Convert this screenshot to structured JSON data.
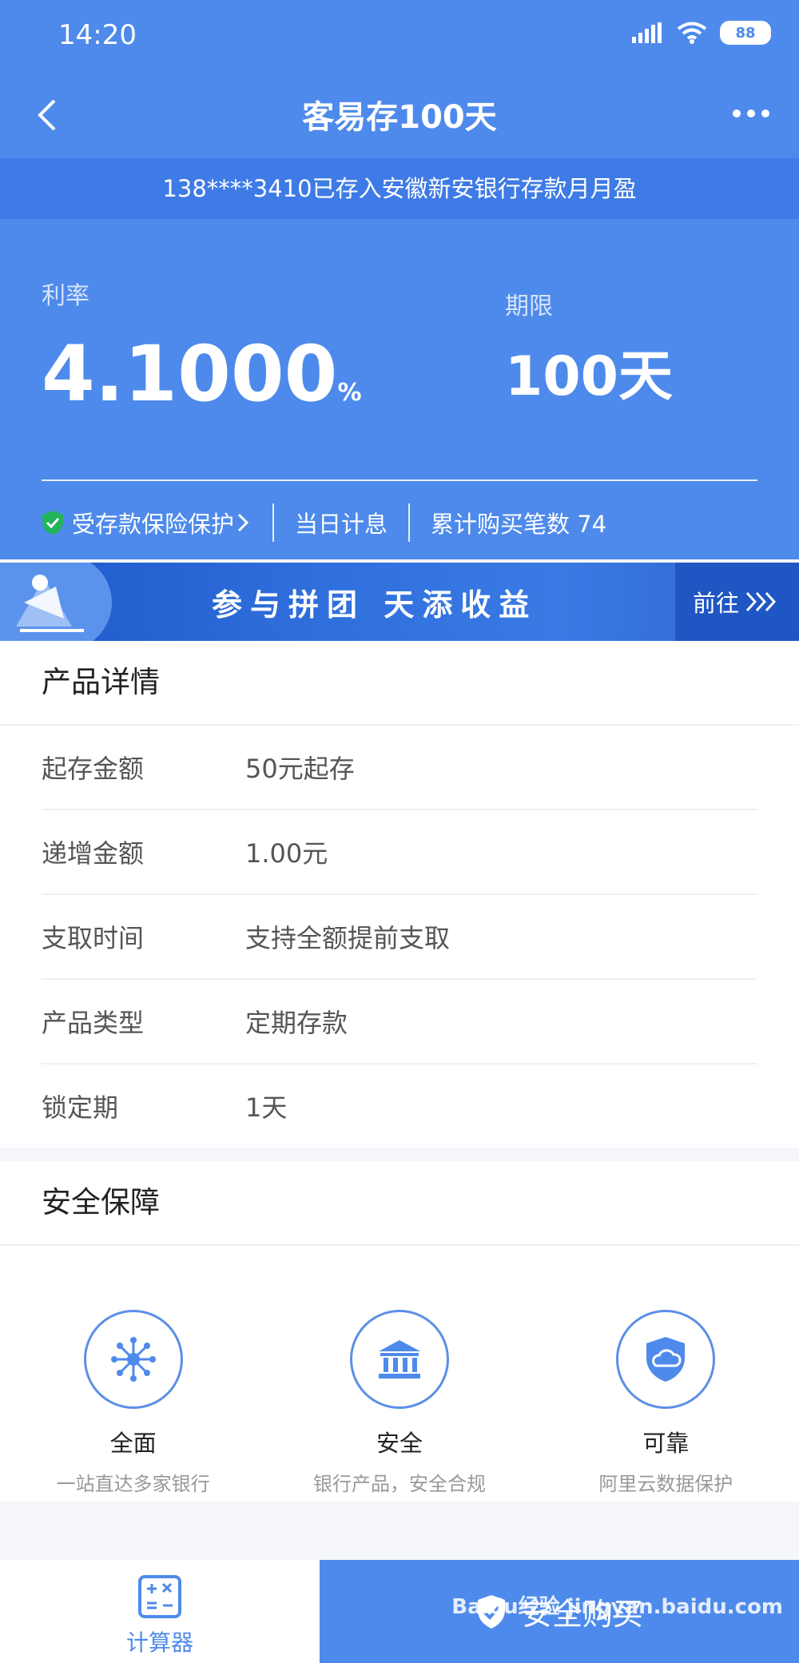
{
  "status_bar": {
    "time": "14:20",
    "battery": "88"
  },
  "nav": {
    "title": "客易存100天"
  },
  "ticker": {
    "text": "138****3410已存入安徽新安银行存款月月盈"
  },
  "rate": {
    "label": "利率",
    "value": "4.1000",
    "unit": "%"
  },
  "term": {
    "label": "期限",
    "value": "100天"
  },
  "features": {
    "insured": "受存款保险保护",
    "interest": "当日计息",
    "purchases": "累计购买笔数 74"
  },
  "banner": {
    "text": "参与拼团 天添收益",
    "go": "前往"
  },
  "details": {
    "title": "产品详情",
    "rows": [
      {
        "label": "起存金额",
        "value": "50元起存"
      },
      {
        "label": "递增金额",
        "value": "1.00元"
      },
      {
        "label": "支取时间",
        "value": "支持全额提前支取"
      },
      {
        "label": "产品类型",
        "value": "定期存款"
      },
      {
        "label": "锁定期",
        "value": "1天"
      }
    ]
  },
  "security": {
    "title": "安全保障",
    "items": [
      {
        "name": "全面",
        "desc": "一站直达多家银行",
        "icon": "network-icon"
      },
      {
        "name": "安全",
        "desc": "银行产品，安全合规",
        "icon": "bank-icon"
      },
      {
        "name": "可靠",
        "desc": "阿里云数据保护",
        "icon": "cloud-shield-icon"
      }
    ]
  },
  "bottom": {
    "calculator": "计算器",
    "buy": "安全购买"
  },
  "watermark": "Baidu经验 jingyan.baidu.com",
  "colors": {
    "primary": "#4e8aeb",
    "ticker": "#3f7be6"
  }
}
